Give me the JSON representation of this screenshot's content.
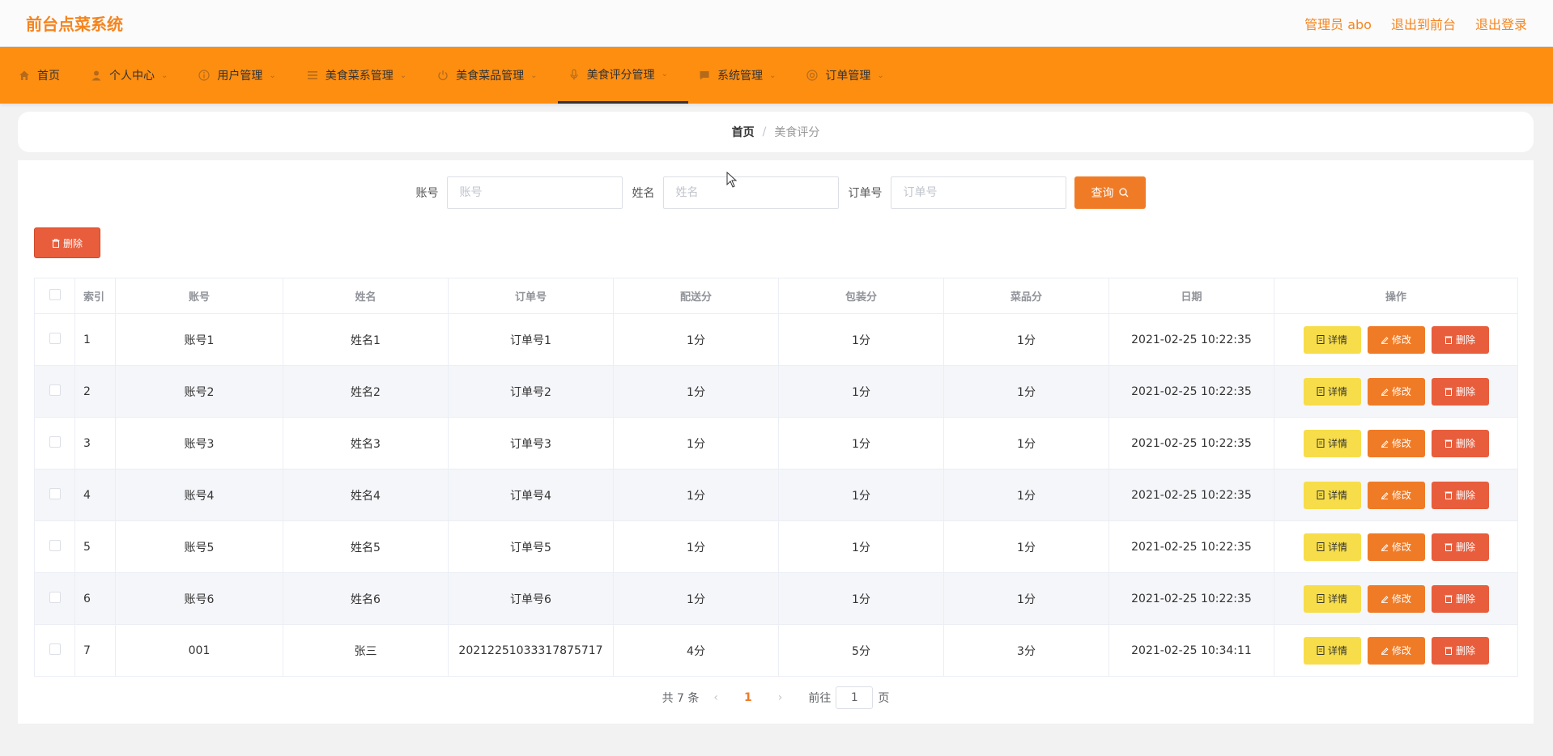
{
  "header": {
    "brand": "前台点菜系统",
    "admin_label": "管理员 abo",
    "back_front": "退出到前台",
    "logout": "退出登录"
  },
  "nav": [
    {
      "label": "首页",
      "icon": "home-icon",
      "has_chevron": false
    },
    {
      "label": "个人中心",
      "icon": "user-icon",
      "has_chevron": true
    },
    {
      "label": "用户管理",
      "icon": "info-icon",
      "has_chevron": true
    },
    {
      "label": "美食菜系管理",
      "icon": "menu-icon",
      "has_chevron": true
    },
    {
      "label": "美食菜品管理",
      "icon": "power-icon",
      "has_chevron": true
    },
    {
      "label": "美食评分管理",
      "icon": "microphone-icon",
      "has_chevron": true,
      "active": true
    },
    {
      "label": "系统管理",
      "icon": "chat-icon",
      "has_chevron": true
    },
    {
      "label": "订单管理",
      "icon": "circle-icon",
      "has_chevron": true
    }
  ],
  "breadcrumb": {
    "home": "首页",
    "separator": "/",
    "current": "美食评分"
  },
  "search": {
    "account_label": "账号",
    "account_placeholder": "账号",
    "name_label": "姓名",
    "name_placeholder": "姓名",
    "order_label": "订单号",
    "order_placeholder": "订单号",
    "query_button": "查询"
  },
  "delete_button": "删除",
  "table": {
    "columns": [
      "索引",
      "账号",
      "姓名",
      "订单号",
      "配送分",
      "包装分",
      "菜品分",
      "日期",
      "操作"
    ],
    "rows": [
      {
        "index": "1",
        "account": "账号1",
        "name": "姓名1",
        "order": "订单号1",
        "delivery": "1分",
        "packing": "1分",
        "dish": "1分",
        "date": "2021-02-25 10:22:35"
      },
      {
        "index": "2",
        "account": "账号2",
        "name": "姓名2",
        "order": "订单号2",
        "delivery": "1分",
        "packing": "1分",
        "dish": "1分",
        "date": "2021-02-25 10:22:35"
      },
      {
        "index": "3",
        "account": "账号3",
        "name": "姓名3",
        "order": "订单号3",
        "delivery": "1分",
        "packing": "1分",
        "dish": "1分",
        "date": "2021-02-25 10:22:35"
      },
      {
        "index": "4",
        "account": "账号4",
        "name": "姓名4",
        "order": "订单号4",
        "delivery": "1分",
        "packing": "1分",
        "dish": "1分",
        "date": "2021-02-25 10:22:35"
      },
      {
        "index": "5",
        "account": "账号5",
        "name": "姓名5",
        "order": "订单号5",
        "delivery": "1分",
        "packing": "1分",
        "dish": "1分",
        "date": "2021-02-25 10:22:35"
      },
      {
        "index": "6",
        "account": "账号6",
        "name": "姓名6",
        "order": "订单号6",
        "delivery": "1分",
        "packing": "1分",
        "dish": "1分",
        "date": "2021-02-25 10:22:35"
      },
      {
        "index": "7",
        "account": "001",
        "name": "张三",
        "order": "20212251033317875717",
        "delivery": "4分",
        "packing": "5分",
        "dish": "3分",
        "date": "2021-02-25 10:34:11"
      }
    ],
    "actions": {
      "detail": "详情",
      "edit": "修改",
      "delete": "删除"
    }
  },
  "pagination": {
    "total": "共 7 条",
    "current_page": "1",
    "goto_label": "前往",
    "goto_value": "1",
    "page_suffix": "页"
  },
  "colors": {
    "brand": "#f5841e",
    "nav_bg": "#fe8e10",
    "query": "#f07b26",
    "delete": "#e85d3c",
    "detail": "#f7dd4a"
  }
}
